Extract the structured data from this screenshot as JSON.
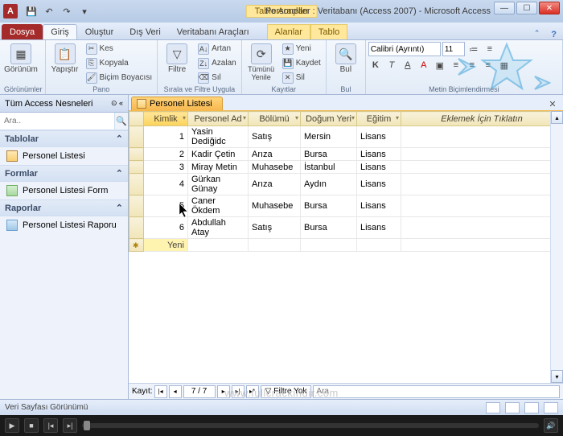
{
  "window": {
    "title": "Personeller : Veritabanı (Access 2007) - Microsoft Access",
    "contextual_heading": "Tablo Araçları",
    "app_letter": "A"
  },
  "ribbon_tabs": {
    "file": "Dosya",
    "home": "Giriş",
    "create": "Oluştur",
    "external": "Dış Veri",
    "dbtools": "Veritabanı Araçları",
    "contextual_fields": "Alanlar",
    "contextual_table": "Tablo"
  },
  "ribbon": {
    "views_group": "Görünümler",
    "view_btn": "Görünüm",
    "clipboard_group": "Pano",
    "paste": "Yapıştır",
    "cut": "Kes",
    "copy": "Kopyala",
    "format_painter": "Biçim Boyacısı",
    "sort_filter_group": "Sırala ve Filtre Uygula",
    "filter": "Filtre",
    "asc": "Artan",
    "desc": "Azalan",
    "clear_sort": "Sıl",
    "records_group": "Kayıtlar",
    "refresh": "Tümünü Yenile",
    "new": "Yeni",
    "save": "Kaydet",
    "delete": "Sil",
    "find_group": "Bul",
    "find": "Bul",
    "textfmt_group": "Metin Biçimlendirmesi",
    "font_name": "Calibri (Ayrıntı)",
    "font_size": "11"
  },
  "nav": {
    "header": "Tüm Access Nesneleri",
    "search_placeholder": "Ara..",
    "tables": "Tablolar",
    "forms": "Formlar",
    "reports": "Raporlar",
    "table_item": "Personel Listesi",
    "form_item": "Personel Listesi Form",
    "report_item": "Personel Listesi Raporu"
  },
  "doc": {
    "tab_title": "Personel Listesi",
    "headers": {
      "id": "Kimlik",
      "name": "Personel Ad",
      "dept": "Bölümü",
      "birthplace": "Doğum Yeri",
      "edu": "Eğitim",
      "add": "Eklemek İçin Tıklatın"
    },
    "rows": [
      {
        "id": "1",
        "name": "Yasin Dediğidc",
        "dept": "Satış",
        "birthplace": "Mersin",
        "edu": "Lisans"
      },
      {
        "id": "2",
        "name": "Kadir Çetin",
        "dept": "Arıza",
        "birthplace": "Bursa",
        "edu": "Lisans"
      },
      {
        "id": "3",
        "name": "Miray Metin",
        "dept": "Muhasebe",
        "birthplace": "İstanbul",
        "edu": "Lisans"
      },
      {
        "id": "4",
        "name": "Gürkan Günay",
        "dept": "Arıza",
        "birthplace": "Aydın",
        "edu": "Lisans"
      },
      {
        "id": "5",
        "name": "Caner Ökdem",
        "dept": "Muhasebe",
        "birthplace": "Bursa",
        "edu": "Lisans"
      },
      {
        "id": "6",
        "name": "Abdullah Atay",
        "dept": "Satış",
        "birthplace": "Bursa",
        "edu": "Lisans"
      }
    ],
    "new_label": "Yeni"
  },
  "recnav": {
    "label": "Kayıt:",
    "position": "7 / 7",
    "no_filter": "Filtre Yok",
    "search_placeholder": "Ara"
  },
  "status": {
    "view": "Veri Sayfası Görünümü"
  },
  "watermark": "www.fullcrackindir.com"
}
